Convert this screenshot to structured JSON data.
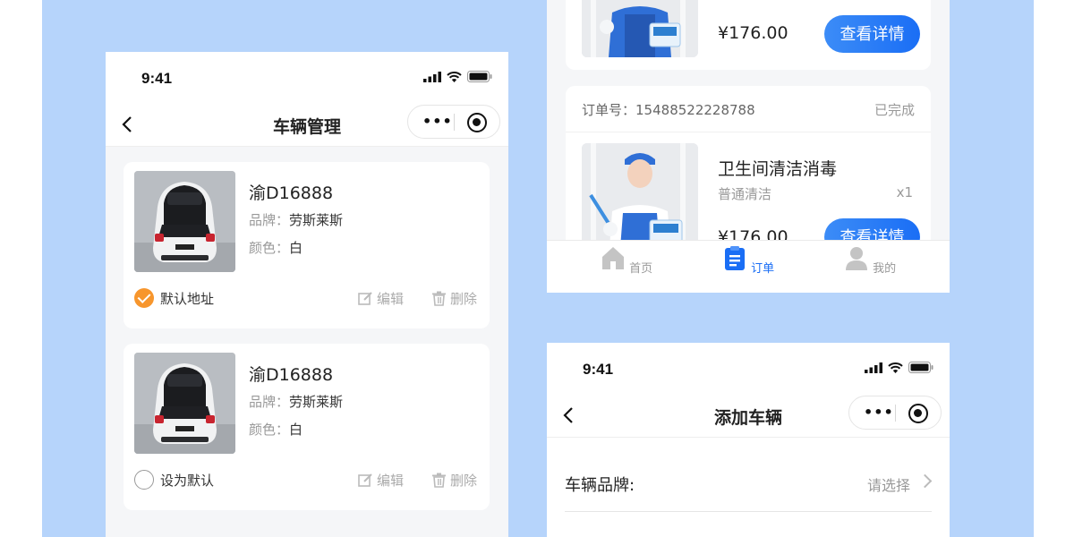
{
  "status": {
    "time": "9:41"
  },
  "vehicles_page": {
    "title": "车辆管理",
    "brand_label": "品牌：",
    "color_label": "颜色：",
    "edit_label": "编辑",
    "delete_label": "删除",
    "vehicles": [
      {
        "plate": "渝D16888",
        "brand": "劳斯莱斯",
        "color": "白",
        "default_text": "默认地址",
        "is_default": true
      },
      {
        "plate": "渝D16888",
        "brand": "劳斯莱斯",
        "color": "白",
        "default_text": "设为默认",
        "is_default": false
      }
    ]
  },
  "orders_page": {
    "detail_button": "查看详情",
    "top_partial": {
      "price": "¥176.00"
    },
    "order": {
      "number_label": "订单号：",
      "number": "15488522228788",
      "status": "已完成",
      "service_name": "卫生间清洁消毒",
      "service_type": "普通清洁",
      "quantity": "x1",
      "price": "¥176.00"
    },
    "tabbar": [
      {
        "label": "首页",
        "icon": "home-icon",
        "active": false
      },
      {
        "label": "订单",
        "icon": "clipboard-icon",
        "active": true
      },
      {
        "label": "我的",
        "icon": "user-icon",
        "active": false
      }
    ]
  },
  "add_vehicle_page": {
    "title": "添加车辆",
    "brand_field_label": "车辆品牌:",
    "brand_field_placeholder": "请选择"
  },
  "colors": {
    "background": "#b6d4fb",
    "accent_blue": "#1a6ef5",
    "accent_orange": "#f7962d"
  }
}
